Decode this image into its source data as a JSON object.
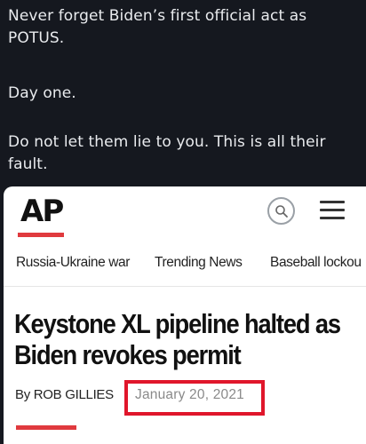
{
  "tweet": {
    "line1": "Never forget Biden’s first official act as\nPOTUS.",
    "line2": "Day one.",
    "line3": "Do not let them lie to you. This is all their\nfault."
  },
  "article": {
    "logo": "AP",
    "nav": [
      "Russia-Ukraine war",
      "Trending News",
      "Baseball lockou"
    ],
    "headline": "Keystone XL pipeline halted as Biden revokes permit",
    "byline": "By ROB GILLIES",
    "date": "January 20, 2021"
  },
  "colors": {
    "dark_bg": "#15181f",
    "accent_red": "#e03a3e",
    "highlight_red": "#e0162b"
  },
  "icons": {
    "search": "search-icon",
    "menu": "hamburger-menu-icon"
  }
}
